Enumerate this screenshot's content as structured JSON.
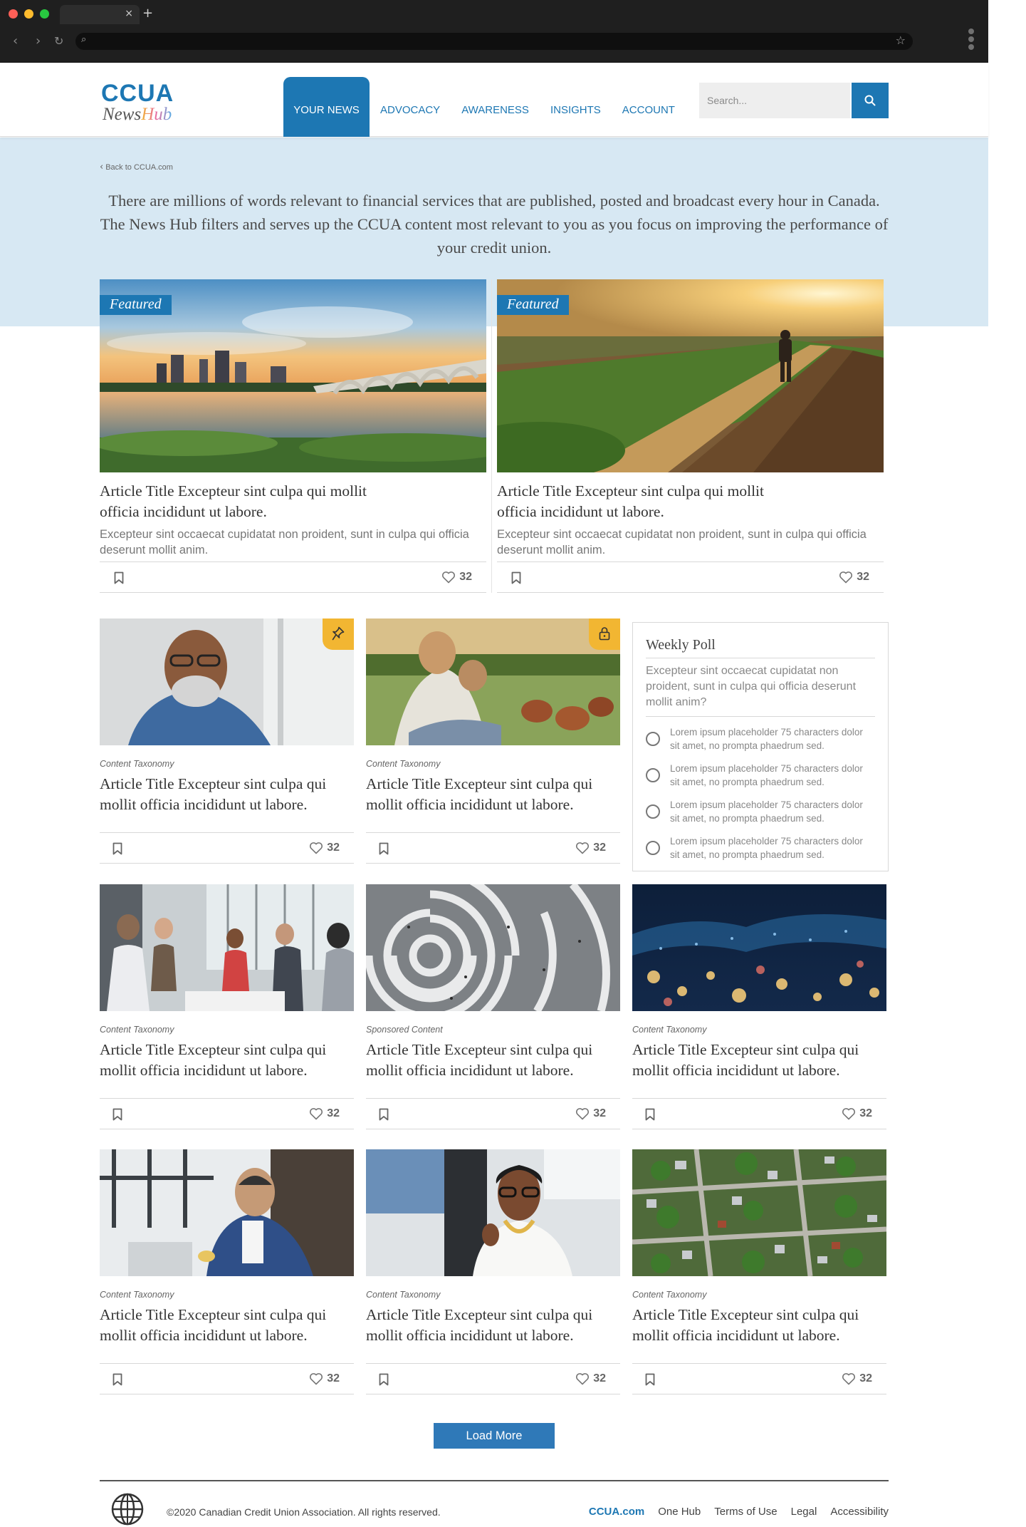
{
  "browser": {
    "tab_close": "×",
    "new_tab": "+",
    "back": "‹",
    "forward": "›",
    "reload": "↻"
  },
  "header": {
    "logo_top": "CCUA",
    "logo_news": "News",
    "logo_hub": "Hub",
    "nav": [
      "YOUR NEWS",
      "ADVOCACY",
      "AWARENESS",
      "INSIGHTS",
      "ACCOUNT"
    ],
    "search_placeholder": "Search..."
  },
  "hero": {
    "back_link": "Back to CCUA.com",
    "text": "There are millions of words relevant to financial services that are published, posted and broadcast every hour in Canada. The News Hub filters and serves up the CCUA content most relevant to you as you focus on improving the performance of your credit union."
  },
  "featured": [
    {
      "badge": "Featured",
      "title": "Article Title Excepteur sint culpa qui mollit officia incididunt ut labore.",
      "desc": "Excepteur sint occaecat cupidatat non proident, sunt in culpa qui officia deserunt mollit anim.",
      "likes": "32",
      "image": "city-bridge-sunset"
    },
    {
      "badge": "Featured",
      "title": "Article Title Excepteur sint culpa qui mollit officia incididunt ut labore.",
      "desc": "Excepteur sint occaecat cupidatat non proident, sunt in culpa qui officia deserunt mollit anim.",
      "likes": "32",
      "image": "farmer-field-sunset"
    }
  ],
  "articles": [
    {
      "taxonomy": "Content Taxonomy",
      "title": "Article Title Excepteur sint culpa qui mollit officia incididunt ut labore.",
      "likes": "32",
      "image": "smiling-man-glasses",
      "badge_icon": "pin-icon"
    },
    {
      "taxonomy": "Content Taxonomy",
      "title": "Article Title Excepteur sint culpa qui mollit officia incididunt ut labore.",
      "likes": "32",
      "image": "woman-child-chickens",
      "badge_icon": "lock-icon"
    },
    {
      "taxonomy": "Content Taxonomy",
      "title": "Article Title Excepteur sint culpa qui mollit officia incididunt ut labore.",
      "likes": "32",
      "image": "office-meeting"
    },
    {
      "taxonomy": "Sponsored Content",
      "title": "Article Title Excepteur sint culpa qui mollit officia incididunt ut labore.",
      "likes": "32",
      "image": "maze-people"
    },
    {
      "taxonomy": "Content Taxonomy",
      "title": "Article Title Excepteur sint culpa qui mollit officia incididunt ut labore.",
      "likes": "32",
      "image": "city-lights-bokeh"
    },
    {
      "taxonomy": "Content Taxonomy",
      "title": "Article Title Excepteur sint culpa qui mollit officia incididunt ut labore.",
      "likes": "32",
      "image": "man-laptop-window"
    },
    {
      "taxonomy": "Content Taxonomy",
      "title": "Article Title Excepteur sint culpa qui mollit officia incididunt ut labore.",
      "likes": "32",
      "image": "woman-office-pen"
    },
    {
      "taxonomy": "Content Taxonomy",
      "title": "Article Title Excepteur sint culpa qui mollit officia incididunt ut labore.",
      "likes": "32",
      "image": "aerial-neighborhood"
    }
  ],
  "poll": {
    "title": "Weekly Poll",
    "question": "Excepteur sint occaecat cupidatat non proident, sunt in culpa qui officia deserunt mollit anim?",
    "options": [
      "Lorem ipsum placeholder 75 characters dolor sit amet, no prompta phaedrum sed.",
      "Lorem ipsum placeholder 75 characters dolor sit amet, no prompta phaedrum sed.",
      "Lorem ipsum placeholder 75 characters dolor sit amet, no prompta phaedrum sed.",
      "Lorem ipsum placeholder 75 characters dolor sit amet, no prompta phaedrum sed."
    ]
  },
  "load_more": "Load More",
  "footer": {
    "copyright": "©2020 Canadian Credit Union Association. All rights reserved.",
    "links": [
      "CCUA.com",
      "One Hub",
      "Terms of Use",
      "Legal",
      "Accessibility"
    ]
  },
  "colors": {
    "brand_blue": "#1d77b3",
    "hero_bg": "#d7e8f3",
    "accent_yellow": "#f2b632"
  }
}
